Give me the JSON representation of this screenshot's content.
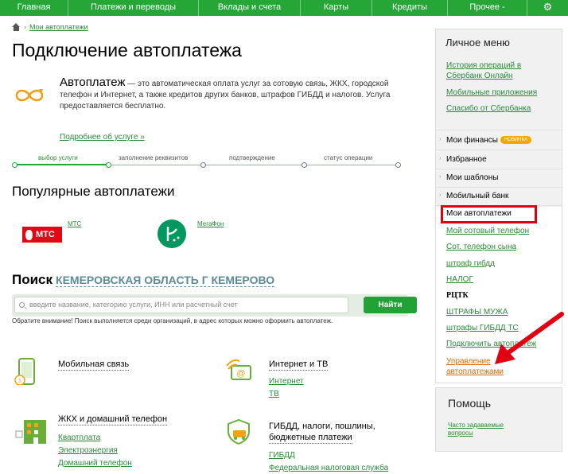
{
  "nav": {
    "items": [
      "Главная",
      "Платежи и переводы",
      "Вклады и счета",
      "Карты",
      "Кредиты",
      "Прочее"
    ],
    "more_caret": "-",
    "gear": "⚙"
  },
  "breadcrumb": {
    "current": "Мои автоплатежи",
    "separator": "›"
  },
  "page": {
    "title": "Подключение автоплатежа"
  },
  "intro": {
    "term": "Автоплатеж",
    "text": " — это автоматическая оплата услуг за сотовую связь, ЖКХ, городской телефон и Интернет, а также кредитов других банков, штрафов ГИБДД и налогов. Услуга предоставляется бесплатно.",
    "more_link": "Подробнее об услуге »"
  },
  "steps": [
    "выбор услуги",
    "заполнение реквизитов",
    "подтверждение",
    "статус операции"
  ],
  "popular": {
    "title": "Популярные автоплатежи",
    "items": [
      {
        "name": "МТС",
        "logo_text": "МТС"
      },
      {
        "name": "МегаФон"
      }
    ]
  },
  "search": {
    "title": "Поиск",
    "region": "КЕМЕРОВСКАЯ ОБЛАСТЬ Г КЕМЕРОВО",
    "placeholder": "введите название, категорию услуги, ИНН или расчетный счет",
    "button": "Найти",
    "note": "Обратите внимание! Поиск выполняется среди организаций, в адрес которых можно оформить автоплатеж."
  },
  "categories": [
    {
      "title": "Мобильная связь",
      "links": []
    },
    {
      "title": "Интернет и ТВ",
      "links": [
        "Интернет",
        "ТВ"
      ]
    },
    {
      "title": "ЖКХ и домашний телефон",
      "links": [
        "Квартплата",
        "Электроэнергия",
        "Домашний телефон"
      ]
    },
    {
      "title_line1": "ГИБДД, налоги, пошлины,",
      "title_line2": "бюджетные платежи",
      "links": [
        "ГИБДД",
        "Федеральная налоговая служба"
      ]
    }
  ],
  "side_menu": {
    "title": "Личное меню",
    "top_links": [
      "История операций в",
      "Сбербанк Онлайн",
      "Мобильные приложения",
      "Спасибо от Сбербанка"
    ],
    "sections": [
      "Мои финансы",
      "Избранное",
      "Мои шаблоны",
      "Мобильный банк"
    ],
    "badge": "НОВИНКА",
    "autopay_items": [
      "Мои автоплатежи",
      "Мой сотовый телефон",
      "Сот. телефон сына",
      "штраф гибдд",
      "НАЛОГ",
      "РЦТК",
      "ШТРАФЫ МУЖА",
      "штрафы ГИБДД ТС",
      "Подключить автоплатеж",
      "Управление",
      "автоплатежами"
    ]
  },
  "help": {
    "title": "Помощь",
    "link_line1": "Часто задаваемые",
    "link_line2": "вопросы"
  },
  "colors": {
    "brand_green": "#25a637",
    "highlight_red": "#e00012",
    "badge_orange": "#f7a600"
  }
}
